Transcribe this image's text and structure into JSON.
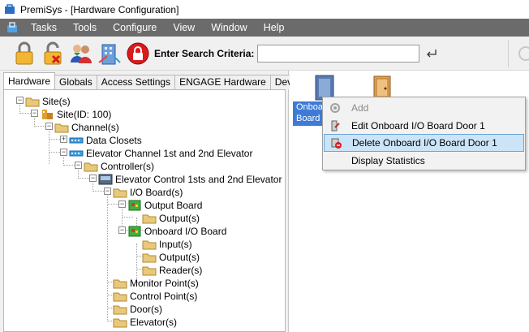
{
  "window": {
    "title": "PremiSys - [Hardware Configuration]"
  },
  "menu": {
    "items": [
      "Tasks",
      "Tools",
      "Configure",
      "View",
      "Window",
      "Help"
    ]
  },
  "toolbar": {
    "buttons": [
      "lock-icon",
      "unlock-icon",
      "users-icon",
      "building-icon",
      "lockdown-icon"
    ],
    "search_label": "Enter Search Criteria:",
    "search_value": "",
    "search_go_icon": "enter-arrow-icon"
  },
  "tabs": [
    "Hardware",
    "Globals",
    "Access Settings",
    "ENGAGE Hardware",
    "Devices"
  ],
  "active_tab": "Hardware",
  "tree": [
    {
      "label": "Site(s)",
      "icon": "folder-icon"
    },
    {
      "label": "Site(ID: 100)",
      "icon": "site-icon"
    },
    {
      "label": "Channel(s)",
      "icon": "folder-icon"
    },
    {
      "label": "Data Closets",
      "icon": "network-icon"
    },
    {
      "label": "Elevator Channel 1st and 2nd Elevator",
      "icon": "network-icon"
    },
    {
      "label": "Controller(s)",
      "icon": "folder-icon"
    },
    {
      "label": "Elevator Control 1sts and 2nd Elevator",
      "icon": "controller-icon"
    },
    {
      "label": "I/O Board(s)",
      "icon": "folder-icon"
    },
    {
      "label": "Output Board",
      "icon": "board-icon"
    },
    {
      "label": "Output(s)",
      "icon": "folder-icon"
    },
    {
      "label": "Onboard I/O Board",
      "icon": "board-icon"
    },
    {
      "label": "Input(s)",
      "icon": "folder-icon"
    },
    {
      "label": "Output(s)",
      "icon": "folder-icon"
    },
    {
      "label": "Reader(s)",
      "icon": "folder-icon"
    },
    {
      "label": "Monitor Point(s)",
      "icon": "folder-icon"
    },
    {
      "label": "Control Point(s)",
      "icon": "folder-icon"
    },
    {
      "label": "Door(s)",
      "icon": "folder-icon"
    },
    {
      "label": "Elevator(s)",
      "icon": "folder-icon"
    }
  ],
  "right_panel": {
    "selected_item_label": "Onboard Board",
    "door_icon": "door-icon"
  },
  "context_menu": {
    "items": [
      {
        "label": "Add",
        "icon": "add-gear-icon",
        "enabled": false
      },
      {
        "label": "Edit Onboard I/O Board Door 1",
        "icon": "edit-icon",
        "enabled": true
      },
      {
        "label": "Delete Onboard I/O Board Door 1",
        "icon": "delete-icon",
        "enabled": true,
        "highlighted": true
      },
      {
        "label": "Display Statistics",
        "icon": "",
        "enabled": true
      }
    ]
  },
  "colors": {
    "menubar": "#6b6b6b",
    "selection": "#3d7bd6",
    "highlight": "#cce4f7"
  }
}
